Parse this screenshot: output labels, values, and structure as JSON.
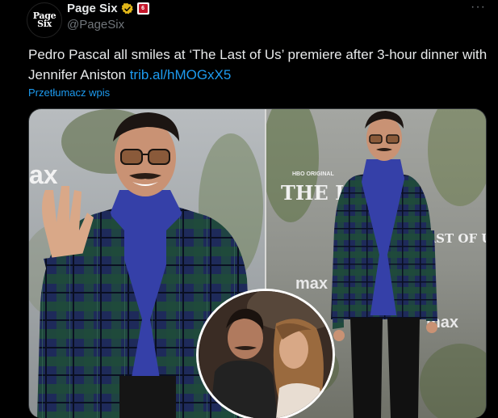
{
  "account": {
    "avatar_line1": "Page",
    "avatar_line2": "Six",
    "display_name": "Page Six",
    "handle": "@PageSix",
    "verified_icon": "verified-gold-check-icon",
    "affiliate_icon": "affiliate-badge-icon",
    "affiliate_badge_text": "6"
  },
  "menu": {
    "icon": "more-dots-icon",
    "label": "···"
  },
  "tweet": {
    "text": "Pedro Pascal all smiles at ‘The Last of Us’ premiere after 3-hour dinner with Jennifer Aniston ",
    "link_text": "trib.al/hMOGxX5",
    "translate_label": "Przetłumacz wpis"
  },
  "media": {
    "left_sign_text": "ax",
    "right_sign_hbo": "HBO ORIGINAL",
    "right_sign_title": "THE LAST",
    "right_sign_title2": "LAST OF US",
    "right_sign_max": "max",
    "right_sign_max2": "max",
    "colors": {
      "jacket_green": "#1f4a3a",
      "jacket_navy": "#1e2a5a",
      "turtleneck": "#3540a8",
      "accent_link": "#1d9bf0",
      "verified_gold": "#e2b719"
    }
  }
}
